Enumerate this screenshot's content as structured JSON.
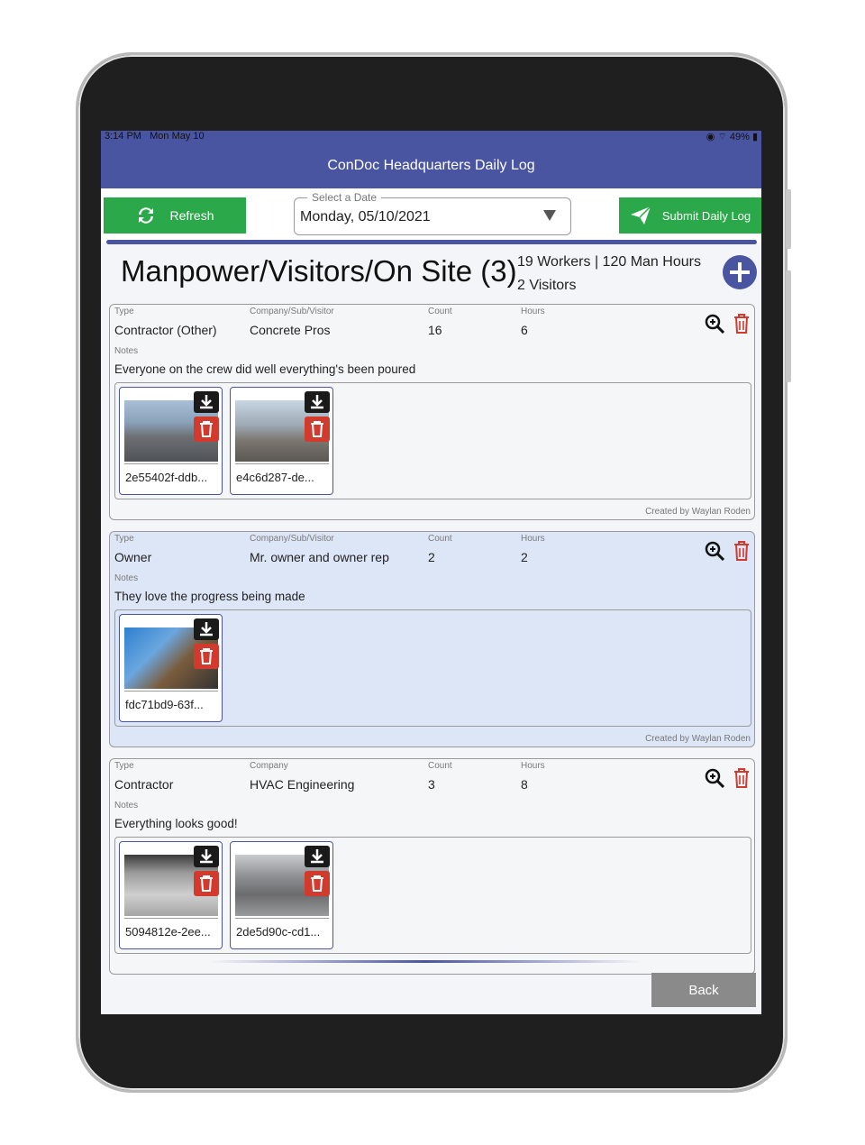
{
  "status": {
    "time": "3:14 PM",
    "date": "Mon May 10",
    "battery": "49%"
  },
  "nav": {
    "title": "ConDoc Headquarters Daily Log"
  },
  "toolbar": {
    "refresh_label": "Refresh",
    "date_legend": "Select a Date",
    "date_value": "Monday, 05/10/2021",
    "submit_label": "Submit Daily Log"
  },
  "section": {
    "title": "Manpower/Visitors/On Site (3)",
    "summary_line1": "19 Workers | 120 Man Hours",
    "summary_line2": "2 Visitors"
  },
  "labels": {
    "type": "Type",
    "company_sub_visitor": "Company/Sub/Visitor",
    "company": "Company",
    "count": "Count",
    "hours": "Hours",
    "notes": "Notes",
    "created_by": "Created by  Waylan Roden"
  },
  "entries": [
    {
      "type": "Contractor (Other)",
      "company": "Concrete Pros",
      "count": "16",
      "hours": "6",
      "notes": "Everyone on the crew did well everything's been poured",
      "attachments": [
        "2e55402f-ddb...",
        "e4c6d287-de..."
      ]
    },
    {
      "type": "Owner",
      "company": "Mr. owner and owner rep",
      "count": "2",
      "hours": "2",
      "notes": "They love the progress being made",
      "attachments": [
        "fdc71bd9-63f..."
      ]
    },
    {
      "type": "Contractor",
      "company": "HVAC Engineering",
      "count": "3",
      "hours": "8",
      "notes": "Everything looks good!",
      "attachments": [
        "5094812e-2ee...",
        "2de5d90c-cd1..."
      ]
    }
  ],
  "footer": {
    "back_label": "Back"
  },
  "colors": {
    "primary": "#4a55a2",
    "green": "#2aa84a",
    "danger": "#d23a2e",
    "alt_card": "#dde6f7"
  }
}
